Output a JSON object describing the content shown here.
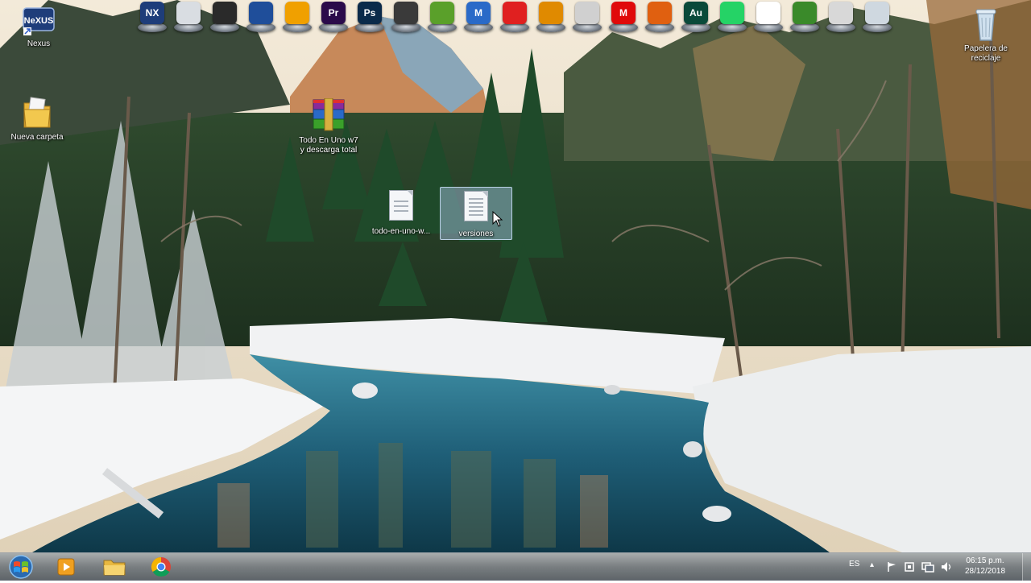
{
  "desktop": {
    "icons": [
      {
        "id": "nexus",
        "label": "Nexus"
      },
      {
        "id": "papelera",
        "label": "Papelera de reciclaje"
      },
      {
        "id": "carpeta",
        "label": "Nueva carpeta"
      },
      {
        "id": "winrar",
        "label_line1": "Todo En Uno w7",
        "label_line2": "y descarga total"
      },
      {
        "id": "todo-en-uno",
        "label": "todo-en-uno-w..."
      },
      {
        "id": "versiones",
        "label": "versiones"
      }
    ]
  },
  "dock": {
    "items": [
      {
        "id": "nexus",
        "icon": "nexus-icon",
        "text": "NX",
        "color": "#1e3d7a"
      },
      {
        "id": "files",
        "icon": "folder-icon",
        "text": "",
        "color": "#d9dde2"
      },
      {
        "id": "obs",
        "icon": "obs-icon",
        "text": "",
        "color": "#2a2a2a"
      },
      {
        "id": "movie",
        "icon": "clapper-icon",
        "text": "",
        "color": "#1f4e9a"
      },
      {
        "id": "audacity",
        "icon": "headphones-icon",
        "text": "",
        "color": "#f0a000"
      },
      {
        "id": "premiere",
        "icon": "premiere-icon",
        "text": "Pr",
        "color": "#2a0a4a"
      },
      {
        "id": "photoshop",
        "icon": "photoshop-icon",
        "text": "Ps",
        "color": "#0a2a4a"
      },
      {
        "id": "tool",
        "icon": "tool-icon",
        "text": "",
        "color": "#3a3a3a"
      },
      {
        "id": "bluestacks",
        "icon": "stack-icon",
        "text": "",
        "color": "#5aa02a"
      },
      {
        "id": "meocloud",
        "icon": "m-logo-icon",
        "text": "M",
        "color": "#2a6ac8"
      },
      {
        "id": "cam",
        "icon": "camera-icon",
        "text": "",
        "color": "#e02020"
      },
      {
        "id": "firefly",
        "icon": "flame-icon",
        "text": "",
        "color": "#e08a00"
      },
      {
        "id": "flash",
        "icon": "lightning-icon",
        "text": "",
        "color": "#d0d0d0"
      },
      {
        "id": "mega",
        "icon": "mega-icon",
        "text": "M",
        "color": "#e00a0a"
      },
      {
        "id": "dfu",
        "icon": "puzzle-icon",
        "text": "",
        "color": "#e06010"
      },
      {
        "id": "audition",
        "icon": "audition-icon",
        "text": "Au",
        "color": "#0a4a3a"
      },
      {
        "id": "whatsapp",
        "icon": "whatsapp-icon",
        "text": "",
        "color": "#25d366"
      },
      {
        "id": "chrome",
        "icon": "chrome-icon",
        "text": "",
        "color": "#ffffff"
      },
      {
        "id": "globe",
        "icon": "globe-icon",
        "text": "",
        "color": "#3a8a2a"
      },
      {
        "id": "clock",
        "icon": "clock-icon",
        "text": "",
        "color": "#d8d8d8"
      },
      {
        "id": "trash",
        "icon": "trash-icon",
        "text": "",
        "color": "#cfd8e0"
      }
    ]
  },
  "taskbar": {
    "language": "ES",
    "time": "06:15 p.m.",
    "date": "28/12/2018"
  }
}
